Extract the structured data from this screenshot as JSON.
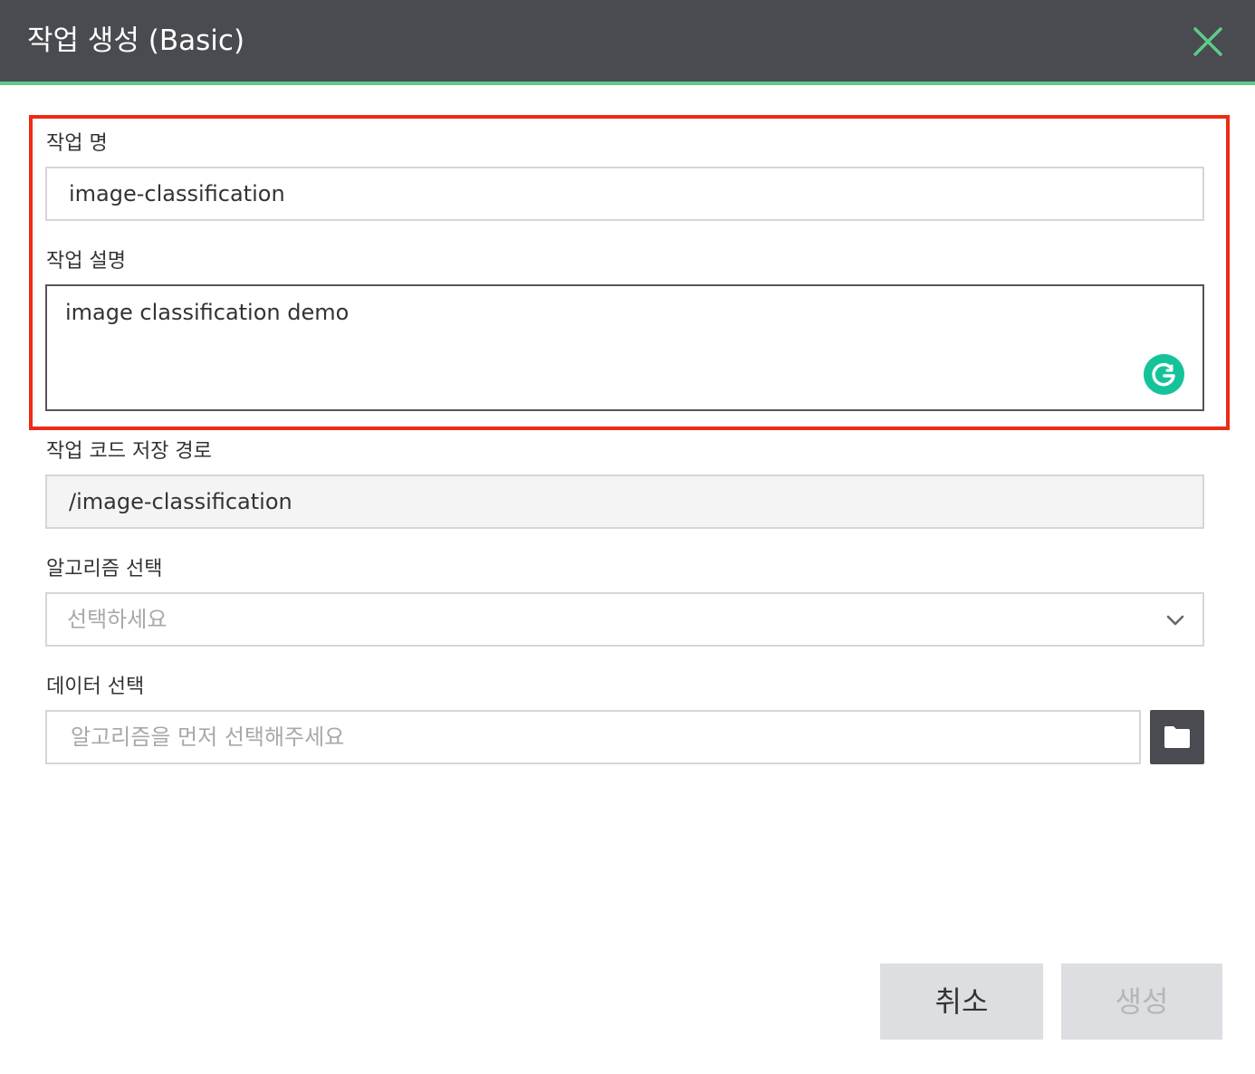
{
  "dialog": {
    "title": "작업 생성 (Basic)",
    "close_icon": "close-icon",
    "accent_color": "#5ecb88",
    "header_color": "#4a4b51"
  },
  "form": {
    "job_name": {
      "label": "작업 명",
      "value": "image-classification"
    },
    "job_description": {
      "label": "작업 설명",
      "value": "image classification demo"
    },
    "code_path": {
      "label": "작업 코드 저장 경로",
      "value": "/image-classification"
    },
    "algorithm": {
      "label": "알고리즘 선택",
      "selected": "선택하세요"
    },
    "data": {
      "label": "데이터 선택",
      "placeholder": "알고리즘을 먼저 선택해주세요",
      "browse_icon": "folder-icon"
    }
  },
  "footer": {
    "cancel_label": "취소",
    "create_label": "생성"
  },
  "highlight_color": "#ee2b14"
}
